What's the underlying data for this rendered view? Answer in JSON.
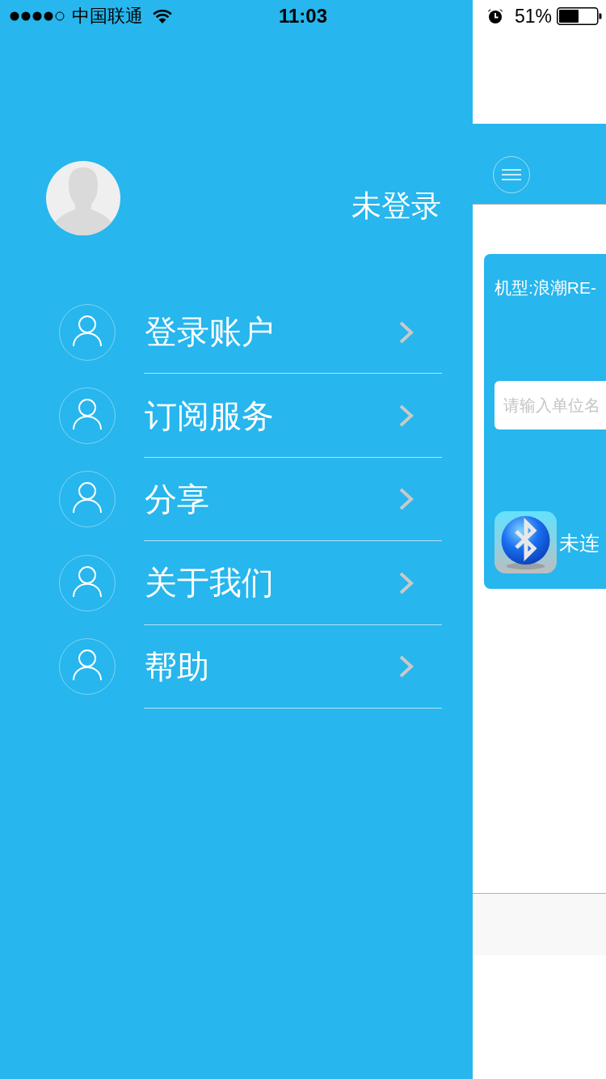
{
  "status_bar": {
    "carrier": "中国联通",
    "time": "11:03",
    "battery_text": "51%"
  },
  "drawer": {
    "user_name": "未登录",
    "menu": [
      {
        "label": "登录账户"
      },
      {
        "label": "订阅服务"
      },
      {
        "label": "分享"
      },
      {
        "label": "关于我们"
      },
      {
        "label": "帮助"
      }
    ]
  },
  "main": {
    "model_label": "机型:浪潮RE-",
    "search": {
      "placeholder": "请输入单位名"
    },
    "bluetooth_status": "未连"
  }
}
